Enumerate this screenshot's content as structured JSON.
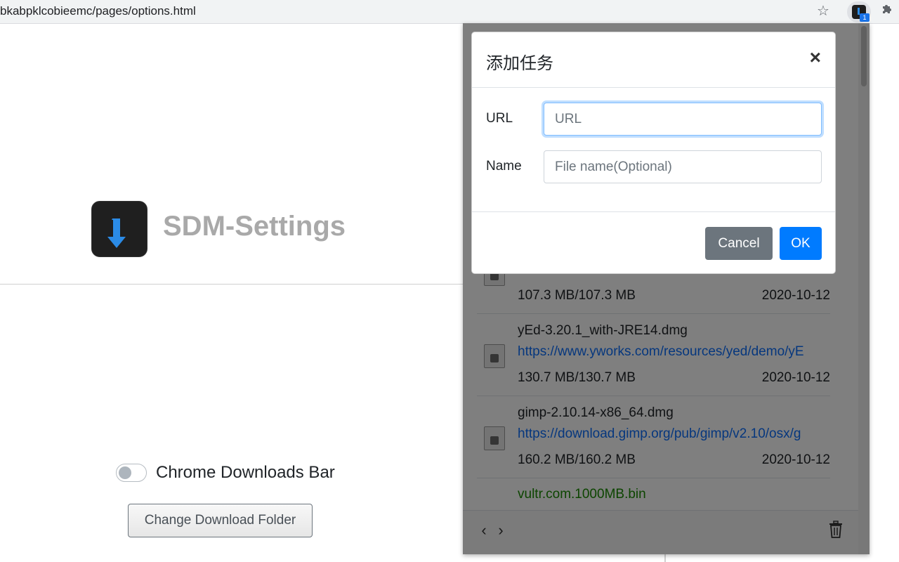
{
  "browser": {
    "url": "bkabpklcobieemc/pages/options.html",
    "bookmark_icon": "star-icon",
    "extension_badge": "1",
    "extensions_icon": "puzzle-icon"
  },
  "options": {
    "title": "SDM-Settings",
    "toggle_label": "Chrome Downloads Bar",
    "change_folder_label": "Change Download Folder"
  },
  "popup": {
    "items": [
      {
        "name": "",
        "url": "",
        "size": "107.3 MB/107.3 MB",
        "date": "2020-10-12"
      },
      {
        "name": "yEd-3.20.1_with-JRE14.dmg",
        "url": "https://www.yworks.com/resources/yed/demo/yE",
        "size": "130.7 MB/130.7 MB",
        "date": "2020-10-12"
      },
      {
        "name": "gimp-2.10.14-x86_64.dmg",
        "url": "https://download.gimp.org/pub/gimp/v2.10/osx/g",
        "size": "160.2 MB/160.2 MB",
        "date": "2020-10-12"
      }
    ],
    "partial_item_name": "vultr.com.1000MB.bin",
    "prev_icon": "chevron-left-icon",
    "next_icon": "chevron-right-icon",
    "trash_icon": "trash-icon"
  },
  "modal": {
    "title": "添加任务",
    "close": "×",
    "url_label": "URL",
    "url_placeholder": "URL",
    "name_label": "Name",
    "name_placeholder": "File name(Optional)",
    "cancel_label": "Cancel",
    "ok_label": "OK"
  },
  "colors": {
    "primary": "#007bff",
    "secondary": "#6c757d",
    "link": "#0d6efd",
    "success": "#198a00"
  }
}
